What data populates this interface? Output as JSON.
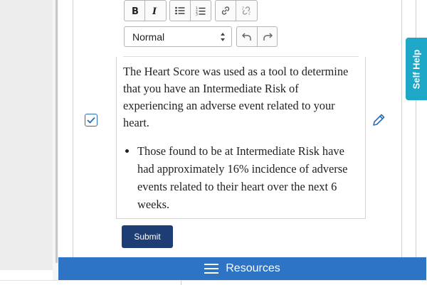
{
  "toolbar": {
    "bold_icon": "bold-icon",
    "italic_icon": "italic-icon",
    "bullet_list_icon": "bullet-list-icon",
    "numbered_list_icon": "numbered-list-icon",
    "link_icon": "link-icon",
    "unlink_icon": "unlink-icon",
    "undo_icon": "undo-icon",
    "redo_icon": "redo-icon",
    "format_select_value": "Normal"
  },
  "editor": {
    "paragraph": "The Heart Score was used as a tool to determine that you have an Intermediate Risk of experiencing an adverse event related to your heart.",
    "bullets": [
      "Those found to be at Intermediate Risk have had approximately 16% incidence of adverse events related to their heart over the next 6 weeks."
    ]
  },
  "checkbox": {
    "checked": true
  },
  "buttons": {
    "submit_label": "Submit"
  },
  "resources_bar": {
    "label": "Resources"
  },
  "self_help": {
    "label": "Self Help"
  },
  "colors": {
    "accent_blue": "#2d74c4",
    "submit_navy": "#1d3d74",
    "self_help_teal": "#1ea7c7"
  }
}
